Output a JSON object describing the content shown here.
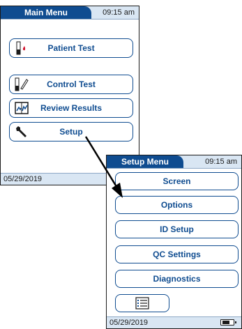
{
  "main_menu": {
    "title": "Main Menu",
    "time": "09:15 am",
    "date": "05/29/2019",
    "buttons": [
      {
        "label": "Patient Test",
        "icon": "test-strip-blood-drop-icon"
      },
      {
        "label": "Control Test",
        "icon": "test-strip-pipette-icon"
      },
      {
        "label": "Review Results",
        "icon": "results-book-icon"
      },
      {
        "label": "Setup",
        "icon": "wrench-icon"
      }
    ]
  },
  "setup_menu": {
    "title": "Setup Menu",
    "time": "09:15 am",
    "date": "05/29/2019",
    "buttons": [
      {
        "label": "Screen"
      },
      {
        "label": "Options"
      },
      {
        "label": "ID Setup"
      },
      {
        "label": "QC Settings"
      },
      {
        "label": "Diagnostics"
      }
    ],
    "list_button_icon": "list-icon",
    "battery_icon": "battery-icon"
  },
  "colors": {
    "accent": "#0f4c90",
    "title_bar": "#d9e6f3",
    "blood_drop": "#d0112b"
  }
}
